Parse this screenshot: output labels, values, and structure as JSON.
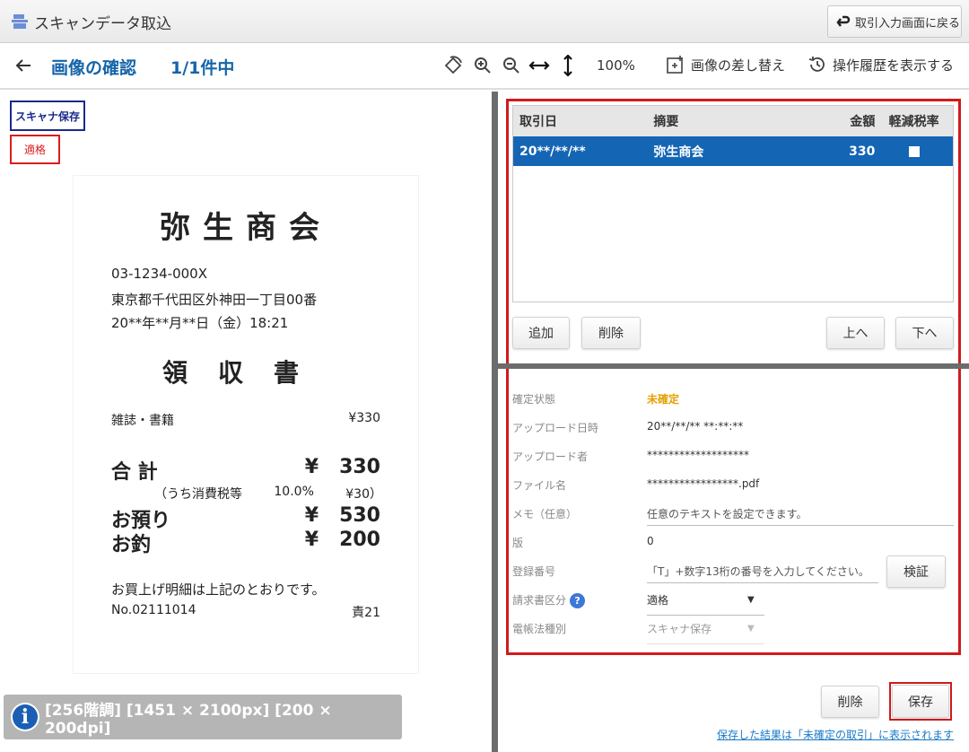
{
  "titlebar": {
    "title": "スキャンデータ取込",
    "back_label": "取引入力画面に戻る"
  },
  "toolbar": {
    "page_title": "画像の確認",
    "page_count": "1/1件中",
    "zoom": "100%",
    "replace_label": "画像の差し替え",
    "history_label": "操作履歴を表示する"
  },
  "badges": {
    "scanner": "スキャナ保存",
    "qualified": "適格"
  },
  "receipt": {
    "store": "弥生商会",
    "phone": "03-1234-000X",
    "address": "東京都千代田区外神田一丁目00番",
    "datetime": "20**年**月**日（金）18:21",
    "title": "領収書",
    "item_name": "雑誌・書籍",
    "item_price": "¥330",
    "total_label": "合 計",
    "total_yen": "¥",
    "total_value": "330",
    "tax_label": "（うち消費税等",
    "tax_rate": "10.0%",
    "tax_value": "¥30）",
    "paid_label": "お預り",
    "paid_value": "530",
    "change_label": "お釣",
    "change_value": "200",
    "thanks": "お買上げ明細は上記のとおりです。",
    "number": "No.02111014",
    "staff": "責21"
  },
  "image_info": "[256階調] [1451 × 2100px] [200 × 200dpi]",
  "grid": {
    "headers": [
      "取引日",
      "摘要",
      "金額",
      "軽減税率"
    ],
    "row": {
      "date": "20**/**/**",
      "desc": "弥生商会",
      "amount": "330"
    }
  },
  "buttons": {
    "add": "追加",
    "delete": "削除",
    "up": "上へ",
    "down": "下へ",
    "verify": "検証",
    "bottom_delete": "削除",
    "save": "保存"
  },
  "form": {
    "status_label": "確定状態",
    "status_value": "未確定",
    "upload_date_label": "アップロード日時",
    "upload_date_value": "20**/**/** **:**:**",
    "uploader_label": "アップロード者",
    "uploader_value": "*******************",
    "file_label": "ファイル名",
    "file_value": "*****************.pdf",
    "memo_label": "メモ（任意）",
    "memo_placeholder": "任意のテキストを設定できます。",
    "version_label": "版",
    "version_value": "0",
    "reg_label": "登録番号",
    "reg_placeholder": "「T」+数字13桁の番号を入力してください。",
    "invoice_label": "請求書区分",
    "invoice_value": "適格",
    "ebook_label": "電帳法種別",
    "ebook_value": "スキャナ保存"
  },
  "save_note": "保存した結果は「未確定の取引」に表示されます",
  "colors": {
    "accent_blue": "#1565b5",
    "highlight_red": "#d01b1b",
    "unconfirmed": "#e5a000"
  }
}
